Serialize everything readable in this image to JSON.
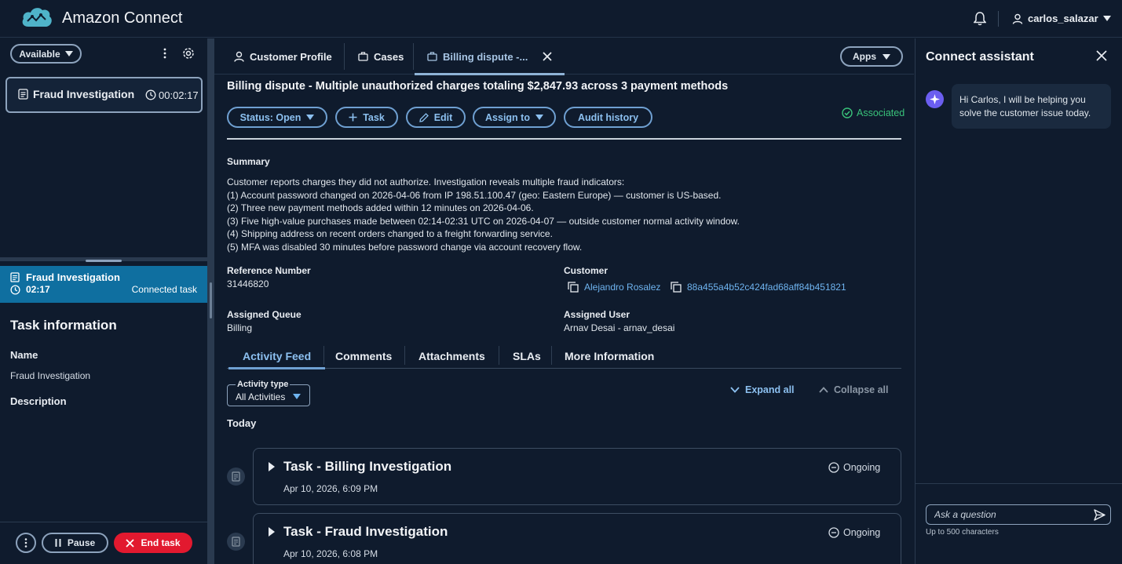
{
  "header": {
    "app_title": "Amazon Connect",
    "user_name": "carlos_salazar"
  },
  "left_panel": {
    "status_label": "Available",
    "contact": {
      "name": "Fraud Investigation",
      "timer": "00:02:17"
    },
    "active_task": {
      "title": "Fraud Investigation",
      "timer": "02:17",
      "status": "Connected task"
    },
    "task_info_heading": "Task information",
    "name_label": "Name",
    "name_value": "Fraud Investigation",
    "description_label": "Description",
    "pause_label": "Pause",
    "end_task_label": "End task"
  },
  "tabs": {
    "customer_profile": "Customer Profile",
    "cases": "Cases",
    "billing": "Billing dispute -...",
    "apps": "Apps"
  },
  "case": {
    "title": "Billing dispute - Multiple unauthorized charges totaling $2,847.93 across 3 payment methods",
    "actions": {
      "status": "Status: Open",
      "task": "Task",
      "edit": "Edit",
      "assign": "Assign to",
      "audit": "Audit history"
    },
    "associated": "Associated",
    "summary_heading": "Summary",
    "summary_lines": [
      "Customer reports charges they did not authorize. Investigation reveals multiple fraud indicators:",
      "(1) Account password changed on 2026-04-06 from IP 198.51.100.47 (geo: Eastern Europe) — customer is US-based.",
      "(2) Three new payment methods added within 12 minutes on 2026-04-06.",
      "(3) Five high-value purchases made between 02:14-02:31 UTC on 2026-04-07 — outside customer normal activity window.",
      "(4) Shipping address on recent orders changed to a freight forwarding service.",
      "(5) MFA was disabled 30 minutes before password change via account recovery flow."
    ],
    "reference_label": "Reference Number",
    "reference_value": "31446820",
    "customer_label": "Customer",
    "customer_name": "Alejandro Rosalez",
    "customer_id": "88a455a4b52c424fad68aff84b451821",
    "queue_label": "Assigned Queue",
    "queue_value": "Billing",
    "user_label": "Assigned User",
    "user_value": "Arnav Desai - arnav_desai"
  },
  "subtabs": [
    "Activity Feed",
    "Comments",
    "Attachments",
    "SLAs",
    "More Information"
  ],
  "activity": {
    "type_label": "Activity type",
    "type_value": "All Activities",
    "expand_all": "Expand all",
    "collapse_all": "Collapse all",
    "today": "Today",
    "items": [
      {
        "title": "Task - Billing Investigation",
        "date": "Apr 10, 2026, 6:09 PM",
        "status": "Ongoing"
      },
      {
        "title": "Task - Fraud Investigation",
        "date": "Apr 10, 2026, 6:08 PM",
        "status": "Ongoing"
      }
    ]
  },
  "assistant": {
    "title": "Connect assistant",
    "message": "Hi Carlos, I will be helping you solve the customer issue today.",
    "input_placeholder": "Ask a question",
    "char_limit": "Up to 500 characters"
  },
  "colors": {
    "background": "#0f1b2d",
    "accent": "#6fb4f0",
    "task_bar": "#0f6fa0",
    "end_button": "#e2192f",
    "associated": "#39c27a"
  }
}
